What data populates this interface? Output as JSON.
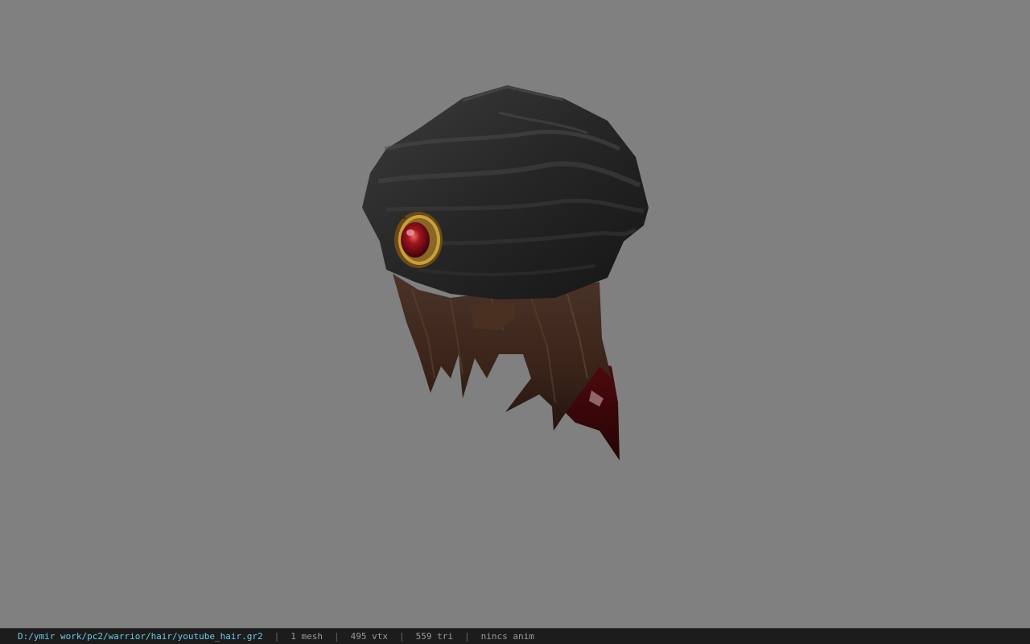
{
  "viewport": {
    "background": "#808080",
    "model": "hair-helmet-mesh"
  },
  "statusbar": {
    "path": "D:/ymir work/pc2/warrior/hair/youtube_hair.gr2",
    "separator": "|",
    "mesh": "1 mesh",
    "vertices": "495 vtx",
    "triangles": "559 tri",
    "anim": "nincs anim",
    "path_color": "#6ec8e8"
  }
}
